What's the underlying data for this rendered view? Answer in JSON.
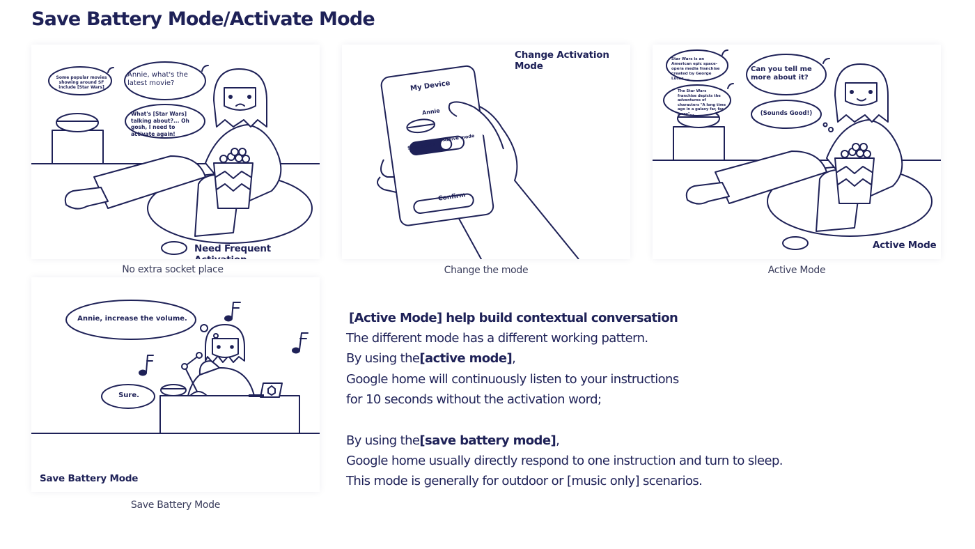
{
  "page_title": "Save Battery Mode/Activate Mode",
  "colors": {
    "ink": "#1e2157",
    "caption": "#3a3d5c",
    "background": "#ffffff"
  },
  "panels": [
    {
      "id": "no-extra-socket",
      "caption": "No extra socket place",
      "corner_label": "Need Frequent Activation",
      "bubbles": [
        "Some popular movies showing around SF include [Star Wars]",
        "Annie, what's the latest movie?",
        "What's [Star Wars] talking about?... Oh gosh, I need to activate again!"
      ]
    },
    {
      "id": "change-mode",
      "caption": "Change the mode",
      "corner_label": "Change Activation Mode",
      "phone": {
        "header": "My Device",
        "device_name": "Annie",
        "toggle_left_label": "Save mode",
        "toggle_right_label": "Active mode",
        "confirm_label": "Confirm"
      }
    },
    {
      "id": "active-mode",
      "caption": "Active Mode",
      "corner_label": "Active Mode",
      "bubbles": [
        "Star Wars is an American epic space-opera media franchise created by George Lucas....",
        "The Star Wars franchise depicts the adventures of characters \"A long time ago in a galaxy far, far away\"...",
        "Can you tell me more about it?",
        "(Sounds Good!)"
      ]
    },
    {
      "id": "save-battery",
      "caption": "Save Battery Mode",
      "corner_label": "Save Battery Mode",
      "bubbles": [
        "Annie, increase the volume.",
        "Sure."
      ]
    }
  ],
  "description": {
    "heading": "[Active Mode] help build contextual conversation",
    "line1": "The different mode has a different working pattern.",
    "line2_prefix": "By using the",
    "line2_bold": "[active mode]",
    "line2_suffix": ",",
    "line3": "Google home will continuously listen to your instructions",
    "line4": "for 10 seconds without the activation word;",
    "line5_prefix": "By using the",
    "line5_bold": "[save battery mode]",
    "line5_suffix": ",",
    "line6": "Google home usually directly respond to one instruction and turn to sleep.",
    "line7": "This mode is generally for outdoor or [music only] scenarios."
  }
}
